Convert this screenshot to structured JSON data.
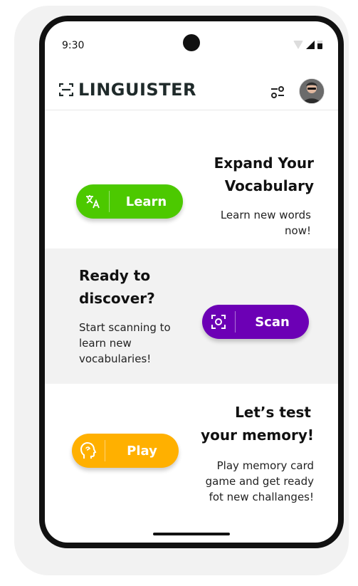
{
  "status": {
    "time": "9:30"
  },
  "header": {
    "logo": "LINGUISTER"
  },
  "sections": [
    {
      "heading_line1": "Expand Your",
      "heading_line2": "Vocabulary",
      "sub_line1": "Learn new words",
      "sub_line2": "now!",
      "button": "Learn",
      "color": "#4cc900"
    },
    {
      "heading_line1": "Ready to",
      "heading_line2": "discover?",
      "sub_line1": "Start scanning to",
      "sub_line2": "learn new",
      "sub_line3": "vocabularies!",
      "button": "Scan",
      "color": "#6c00b5"
    },
    {
      "heading_line1": "Let’s test",
      "heading_line2": "your memory!",
      "sub_line1": "Play memory card",
      "sub_line2": "game and get ready",
      "sub_line3": "fot new challanges!",
      "button": "Play",
      "color": "#ffb000"
    }
  ],
  "icons": [
    "logo-icon",
    "filter-icon",
    "translate-icon",
    "scan-icon",
    "brain-head-icon"
  ]
}
